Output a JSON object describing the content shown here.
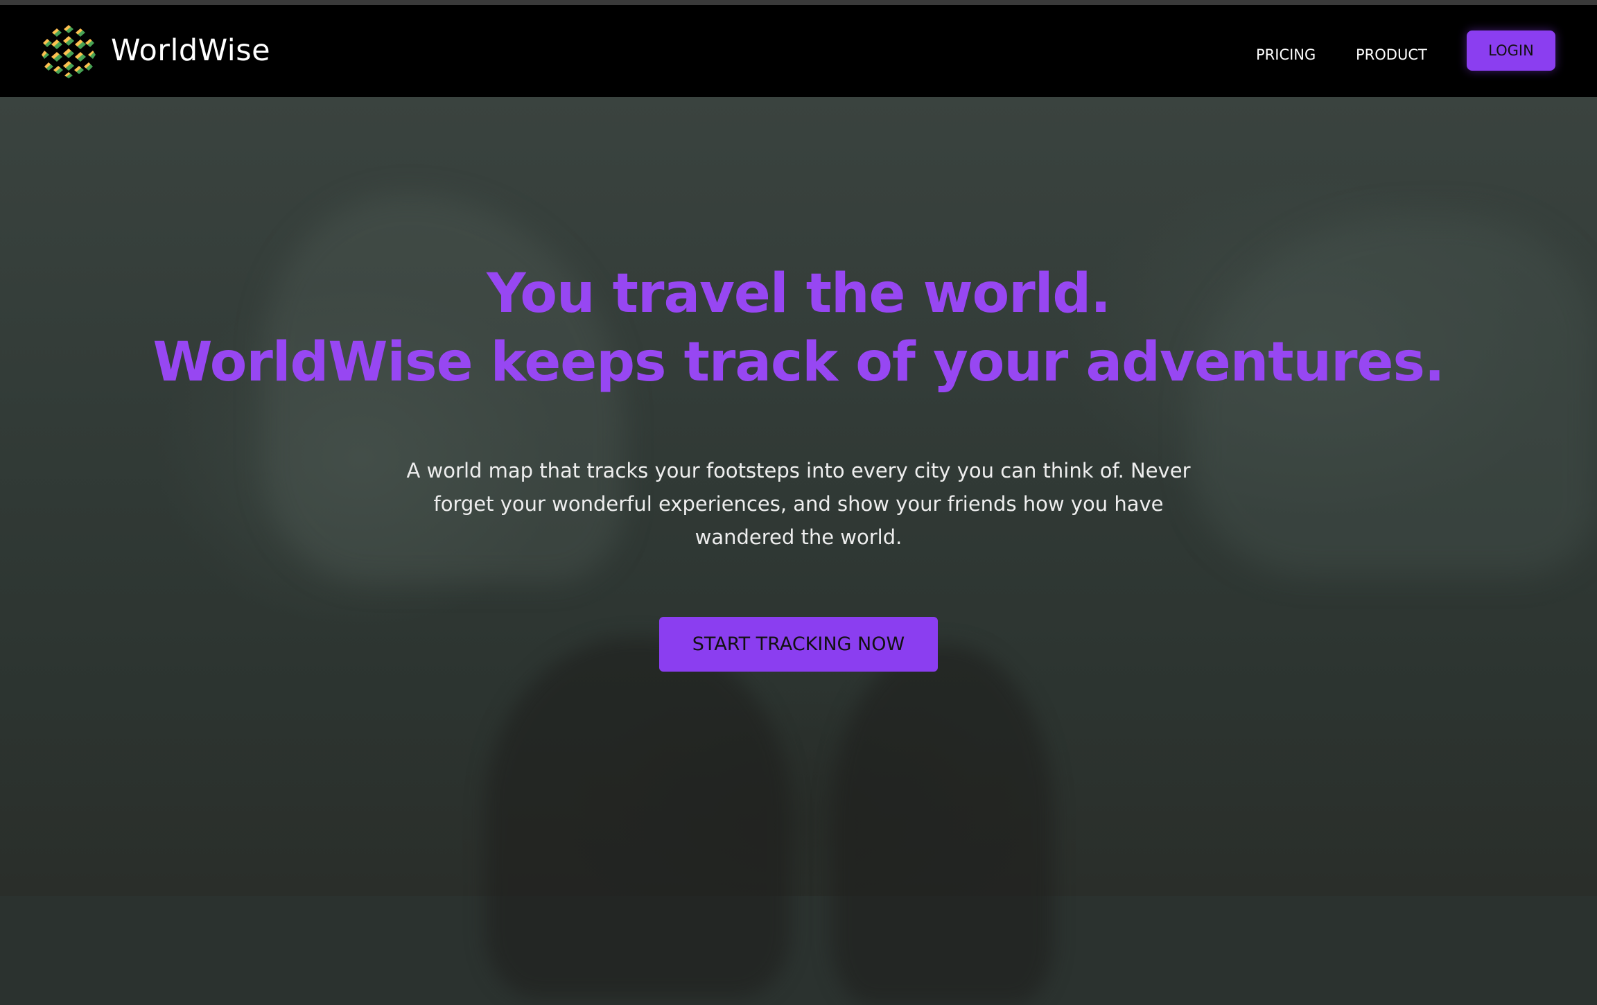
{
  "brand": {
    "name": "WorldWise",
    "logo_icon": "globe-mosaic-icon"
  },
  "nav": {
    "links": [
      {
        "label": "PRICING"
      },
      {
        "label": "PRODUCT"
      }
    ],
    "login_label": "LOGIN"
  },
  "hero": {
    "headline_line1": "You travel the world.",
    "headline_line2": "WorldWise keeps track of your adventures.",
    "description": "A world map that tracks your footsteps into every city you can think of. Never forget your wonderful experiences, and show your friends how you have wandered the world.",
    "cta_label": "START TRACKING NOW"
  },
  "colors": {
    "accent": "#8b3ef0",
    "headline": "#9747f2",
    "navbar_bg": "#000000",
    "logo_green": "#4aa456",
    "logo_orange": "#f3a55a"
  }
}
